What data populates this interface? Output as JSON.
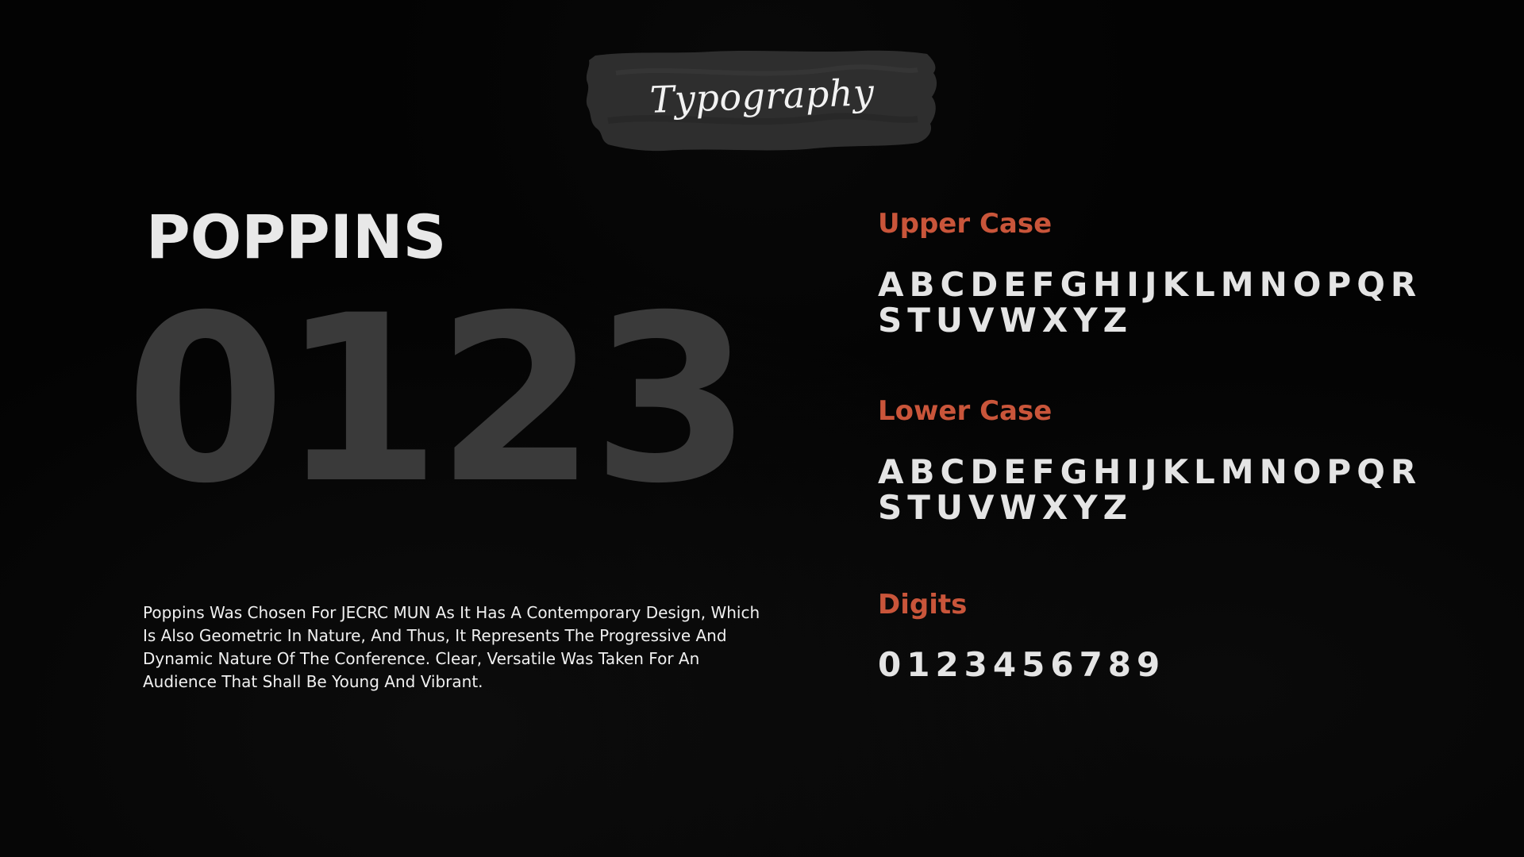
{
  "banner": {
    "title": "Typography"
  },
  "main": {
    "font_name": "POPPINS",
    "sample_digits": "0123",
    "description": "Poppins Was Chosen For JECRC MUN As It Has A Contemporary Design, Which\nIs Also Geometric In Nature, And Thus, It Represents The Progressive And\nDynamic Nature Of The Conference. Clear, Versatile Was Taken For An\nAudience That Shall Be Young And Vibrant."
  },
  "sections": {
    "upper": {
      "label": "Upper Case",
      "line1": "ABCDEFGHIJKLMNOPQR",
      "line2": "STUVWXYZ"
    },
    "lower": {
      "label": "Lower Case",
      "line1": "ABCDEFGHIJKLMNOPQR",
      "line2": "STUVWXYZ"
    },
    "digits": {
      "label": "Digits",
      "line1": "0123456789"
    }
  },
  "colors": {
    "background": "#030303",
    "accent": "#c9553a",
    "text": "#e4e4e4",
    "big_digits": "#3a3a3a",
    "banner_fill": "#2e2e2e"
  }
}
